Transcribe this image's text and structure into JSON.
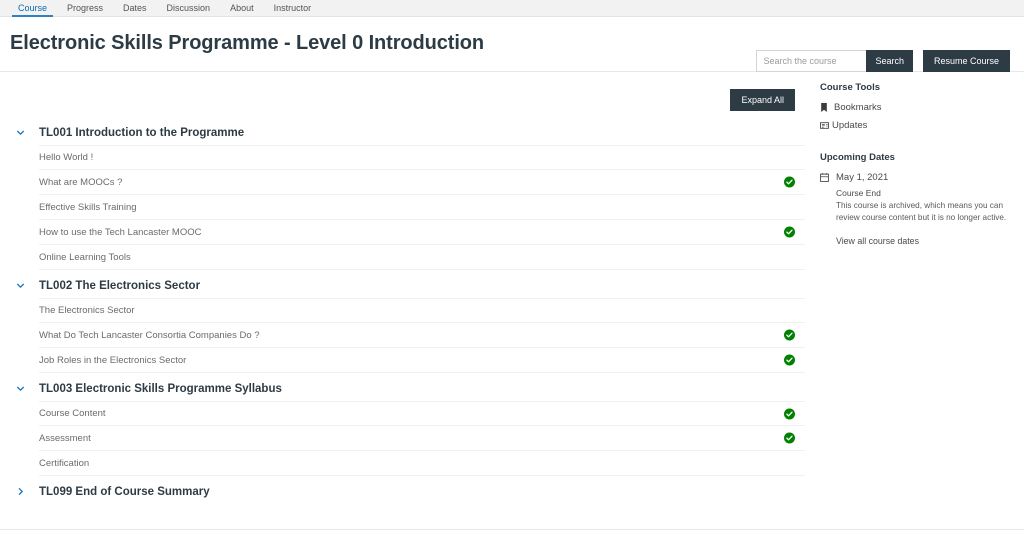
{
  "nav": {
    "tabs": [
      {
        "label": "Course",
        "active": true
      },
      {
        "label": "Progress",
        "active": false
      },
      {
        "label": "Dates",
        "active": false
      },
      {
        "label": "Discussion",
        "active": false
      },
      {
        "label": "About",
        "active": false
      },
      {
        "label": "Instructor",
        "active": false
      }
    ]
  },
  "header": {
    "title": "Electronic Skills Programme - Level 0 Introduction",
    "search_placeholder": "Search the course",
    "search_value": "",
    "search_button": "Search",
    "resume_button": "Resume Course"
  },
  "main": {
    "expand_all_button": "Expand All",
    "sections": [
      {
        "id": "TL001",
        "title": "TL001 Introduction to the Programme",
        "expanded": true,
        "lessons": [
          {
            "name": "Hello World !",
            "completed": false
          },
          {
            "name": "What are MOOCs ?",
            "completed": true
          },
          {
            "name": "Effective Skills Training",
            "completed": false
          },
          {
            "name": "How to use the Tech Lancaster MOOC",
            "completed": true
          },
          {
            "name": "Online Learning Tools",
            "completed": false
          }
        ]
      },
      {
        "id": "TL002",
        "title": "TL002 The Electronics Sector",
        "expanded": true,
        "lessons": [
          {
            "name": "The Electronics Sector",
            "completed": false
          },
          {
            "name": "What Do Tech Lancaster Consortia Companies Do ?",
            "completed": true
          },
          {
            "name": "Job Roles in the Electronics Sector",
            "completed": true
          }
        ]
      },
      {
        "id": "TL003",
        "title": "TL003 Electronic Skills Programme Syllabus",
        "expanded": true,
        "lessons": [
          {
            "name": "Course Content",
            "completed": true
          },
          {
            "name": "Assessment",
            "completed": true
          },
          {
            "name": "Certification",
            "completed": false
          }
        ]
      },
      {
        "id": "TL099",
        "title": "TL099 End of Course Summary",
        "expanded": false,
        "lessons": []
      }
    ]
  },
  "sidebar": {
    "course_tools_heading": "Course Tools",
    "tools": [
      {
        "label": "Bookmarks",
        "icon": "bookmark-icon"
      },
      {
        "label": "Updates",
        "icon": "updates-icon"
      }
    ],
    "upcoming_dates_heading": "Upcoming Dates",
    "date": {
      "date_text": "May 1, 2021",
      "event_title": "Course End",
      "event_description": "This course is archived, which means you can review course content but it is no longer active.",
      "view_all_label": "View all course dates"
    }
  },
  "colors": {
    "accent": "#2a82c8",
    "dark_button": "#2d3b45",
    "complete_green": "#008100",
    "chevron_blue": "#2176b8"
  }
}
